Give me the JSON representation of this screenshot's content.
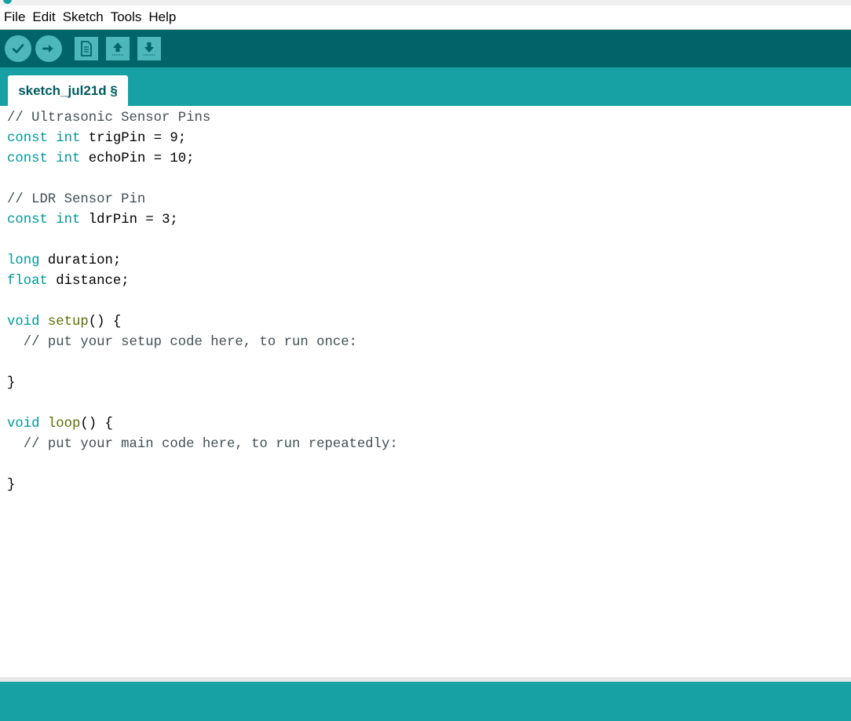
{
  "menubar": {
    "items": [
      "File",
      "Edit",
      "Sketch",
      "Tools",
      "Help"
    ]
  },
  "toolbar": {
    "buttons": [
      "verify-icon",
      "upload-icon",
      "new-icon",
      "open-icon",
      "save-icon"
    ]
  },
  "tabs": [
    {
      "label": "sketch_jul21d §"
    }
  ],
  "editor": {
    "lines": [
      [
        {
          "t": "// Ultrasonic Sensor Pins",
          "c": "cm"
        }
      ],
      [
        {
          "t": "const",
          "c": "kw"
        },
        {
          "t": " ",
          "c": ""
        },
        {
          "t": "int",
          "c": "kw"
        },
        {
          "t": " trigPin = 9;",
          "c": ""
        }
      ],
      [
        {
          "t": "const",
          "c": "kw"
        },
        {
          "t": " ",
          "c": ""
        },
        {
          "t": "int",
          "c": "kw"
        },
        {
          "t": " echoPin = 10;",
          "c": ""
        }
      ],
      [],
      [
        {
          "t": "// LDR Sensor Pin",
          "c": "cm"
        }
      ],
      [
        {
          "t": "const",
          "c": "kw"
        },
        {
          "t": " ",
          "c": ""
        },
        {
          "t": "int",
          "c": "kw"
        },
        {
          "t": " ldrPin = 3;",
          "c": ""
        }
      ],
      [],
      [
        {
          "t": "long",
          "c": "kw"
        },
        {
          "t": " duration;",
          "c": ""
        }
      ],
      [
        {
          "t": "float",
          "c": "kw"
        },
        {
          "t": " distance;",
          "c": ""
        }
      ],
      [],
      [
        {
          "t": "void",
          "c": "kw"
        },
        {
          "t": " ",
          "c": ""
        },
        {
          "t": "setup",
          "c": "fn"
        },
        {
          "t": "() {",
          "c": ""
        }
      ],
      [
        {
          "t": "  // put your setup code here, to run once:",
          "c": "cm"
        }
      ],
      [],
      [
        {
          "t": "}",
          "c": ""
        }
      ],
      [],
      [
        {
          "t": "void",
          "c": "kw"
        },
        {
          "t": " ",
          "c": ""
        },
        {
          "t": "loop",
          "c": "fn"
        },
        {
          "t": "() {",
          "c": ""
        }
      ],
      [
        {
          "t": "  // put your main code here, to run repeatedly:",
          "c": "cm"
        }
      ],
      [],
      [
        {
          "t": "}",
          "c": ""
        }
      ]
    ]
  },
  "colors": {
    "toolbar": "#006468",
    "tabstrip": "#17a1a5",
    "button": "#4db7bb",
    "keyword": "#00979c",
    "function": "#5e6d03",
    "comment": "#434f54"
  }
}
